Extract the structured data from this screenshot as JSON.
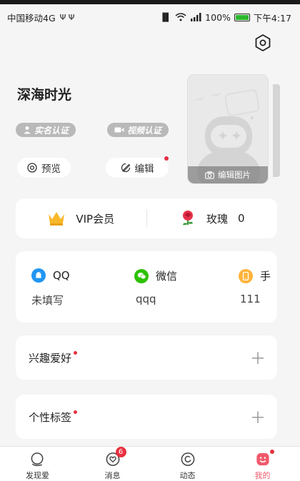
{
  "status_bar": {
    "carrier": "中国移动4G",
    "usb_icons": "Ψ Ψ",
    "battery_percent": "100%",
    "time": "下午4:17",
    "battery_color": "#2eb82e"
  },
  "profile": {
    "name": "深海时光",
    "badges": [
      "实名认证",
      "视频认证"
    ],
    "preview_label": "预览",
    "edit_label": "编辑",
    "edit_photo_label": "编辑图片"
  },
  "vip": {
    "vip_label": "VIP会员",
    "rose_label": "玫瑰",
    "rose_count": "0"
  },
  "contacts": [
    {
      "name": "QQ",
      "value": "未填写",
      "icon": "qq-icon",
      "color": "#2196f3"
    },
    {
      "name": "微信",
      "value": "qqq",
      "icon": "wechat-icon",
      "color": "#2dc100"
    },
    {
      "name": "手",
      "value": "111",
      "icon": "phone-icon",
      "color": "#ffb33a"
    }
  ],
  "sections": [
    {
      "title": "兴趣爱好"
    },
    {
      "title": "个性标签"
    }
  ],
  "tabs": [
    {
      "label": "发现爱",
      "icon": "discover-icon"
    },
    {
      "label": "消息",
      "icon": "message-heart-icon",
      "badge": "6"
    },
    {
      "label": "动态",
      "icon": "moments-icon"
    },
    {
      "label": "我的",
      "icon": "me-icon",
      "active": true
    }
  ],
  "accent": "#f05a6c"
}
